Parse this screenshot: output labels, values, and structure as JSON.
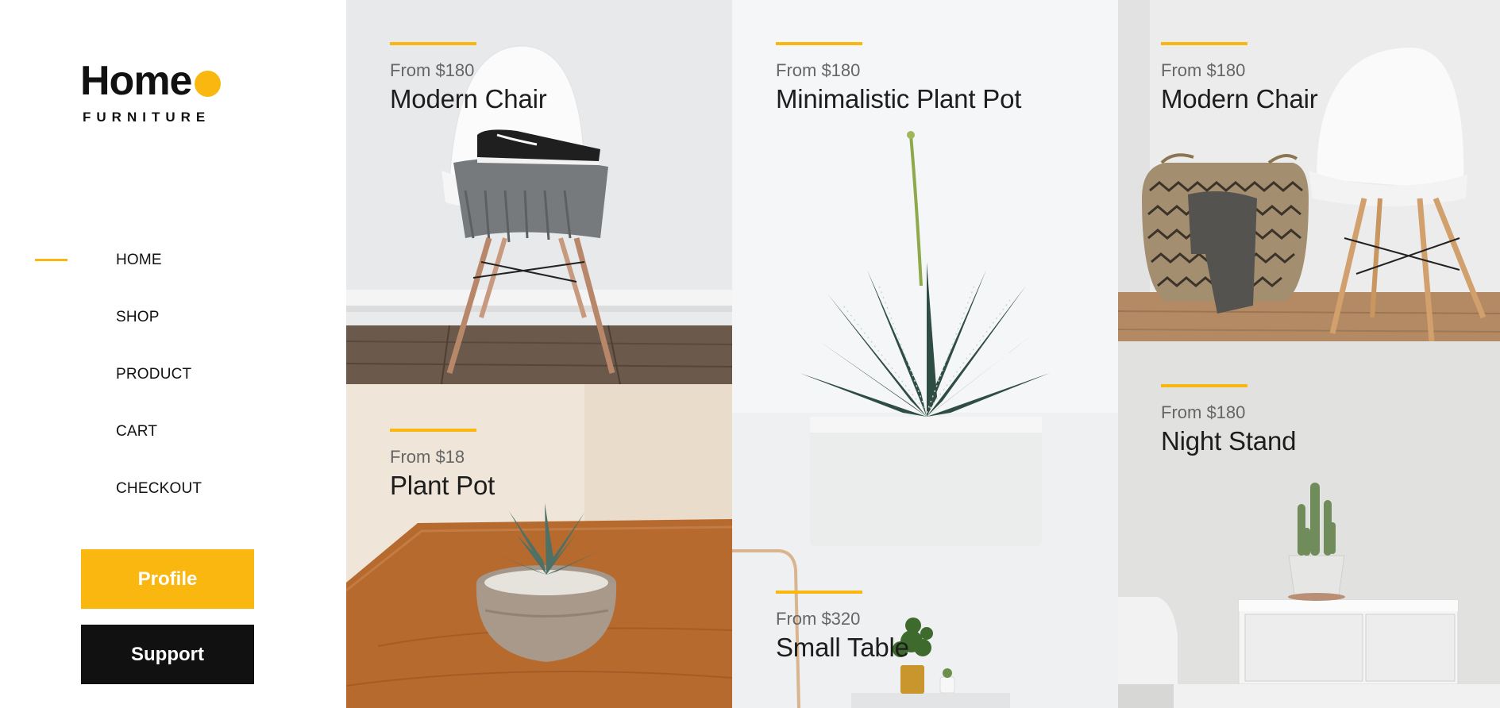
{
  "brand": {
    "name": "Home",
    "tagline": "FURNITURE",
    "accent_color": "#f9b710"
  },
  "nav": {
    "items": [
      {
        "label": "HOME",
        "active": true
      },
      {
        "label": "SHOP",
        "active": false
      },
      {
        "label": "PRODUCT",
        "active": false
      },
      {
        "label": "CART",
        "active": false
      },
      {
        "label": "CHECKOUT",
        "active": false
      }
    ]
  },
  "actions": {
    "profile_label": "Profile",
    "support_label": "Support"
  },
  "products": [
    {
      "price": "From $180",
      "name": "Modern Chair",
      "image": "chair-with-sneakers"
    },
    {
      "price": "From $18",
      "name": "Plant Pot",
      "image": "succulent-on-table"
    },
    {
      "price": "From $180",
      "name": "Minimalistic Plant Pot",
      "image": "aloe-in-white-pot"
    },
    {
      "price": "From $320",
      "name": "Small Table",
      "image": "small-table-with-plant"
    },
    {
      "price": "From $180",
      "name": "Modern Chair",
      "image": "chair-with-basket"
    },
    {
      "price": "From $180",
      "name": "Night Stand",
      "image": "cactus-on-nightstand"
    }
  ]
}
